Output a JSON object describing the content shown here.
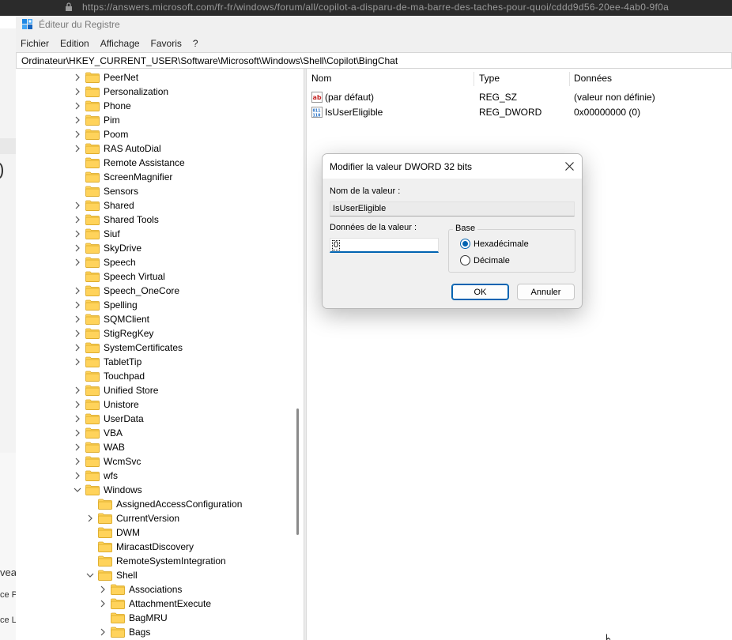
{
  "background": {
    "browser_url": "https://answers.microsoft.com/fr-fr/windows/forum/all/copilot-a-disparu-de-ma-barre-des-taches-pour-quoi/cddd9d56-20ee-4ab0-9f0a",
    "left_fragments": [
      "vea",
      "ce P",
      "ce La"
    ]
  },
  "window": {
    "title": "Éditeur du Registre",
    "icon": "registry-editor-icon"
  },
  "menu": [
    "Fichier",
    "Edition",
    "Affichage",
    "Favoris",
    "?"
  ],
  "address": "Ordinateur\\HKEY_CURRENT_USER\\Software\\Microsoft\\Windows\\Shell\\Copilot\\BingChat",
  "tree": {
    "items": [
      {
        "label": "PeerNet",
        "level": 0,
        "expander": "collapsed"
      },
      {
        "label": "Personalization",
        "level": 0,
        "expander": "collapsed"
      },
      {
        "label": "Phone",
        "level": 0,
        "expander": "collapsed"
      },
      {
        "label": "Pim",
        "level": 0,
        "expander": "collapsed"
      },
      {
        "label": "Poom",
        "level": 0,
        "expander": "collapsed"
      },
      {
        "label": "RAS AutoDial",
        "level": 0,
        "expander": "collapsed"
      },
      {
        "label": "Remote Assistance",
        "level": 0,
        "expander": "none"
      },
      {
        "label": "ScreenMagnifier",
        "level": 0,
        "expander": "none"
      },
      {
        "label": "Sensors",
        "level": 0,
        "expander": "none"
      },
      {
        "label": "Shared",
        "level": 0,
        "expander": "collapsed"
      },
      {
        "label": "Shared Tools",
        "level": 0,
        "expander": "collapsed"
      },
      {
        "label": "Siuf",
        "level": 0,
        "expander": "collapsed"
      },
      {
        "label": "SkyDrive",
        "level": 0,
        "expander": "collapsed"
      },
      {
        "label": "Speech",
        "level": 0,
        "expander": "collapsed"
      },
      {
        "label": "Speech Virtual",
        "level": 0,
        "expander": "none"
      },
      {
        "label": "Speech_OneCore",
        "level": 0,
        "expander": "collapsed"
      },
      {
        "label": "Spelling",
        "level": 0,
        "expander": "collapsed"
      },
      {
        "label": "SQMClient",
        "level": 0,
        "expander": "collapsed"
      },
      {
        "label": "StigRegKey",
        "level": 0,
        "expander": "collapsed"
      },
      {
        "label": "SystemCertificates",
        "level": 0,
        "expander": "collapsed"
      },
      {
        "label": "TabletTip",
        "level": 0,
        "expander": "collapsed"
      },
      {
        "label": "Touchpad",
        "level": 0,
        "expander": "none"
      },
      {
        "label": "Unified Store",
        "level": 0,
        "expander": "collapsed"
      },
      {
        "label": "Unistore",
        "level": 0,
        "expander": "collapsed"
      },
      {
        "label": "UserData",
        "level": 0,
        "expander": "collapsed"
      },
      {
        "label": "VBA",
        "level": 0,
        "expander": "collapsed"
      },
      {
        "label": "WAB",
        "level": 0,
        "expander": "collapsed"
      },
      {
        "label": "WcmSvc",
        "level": 0,
        "expander": "collapsed"
      },
      {
        "label": "wfs",
        "level": 0,
        "expander": "collapsed"
      },
      {
        "label": "Windows",
        "level": 0,
        "expander": "expanded"
      },
      {
        "label": "AssignedAccessConfiguration",
        "level": 1,
        "expander": "none"
      },
      {
        "label": "CurrentVersion",
        "level": 1,
        "expander": "collapsed"
      },
      {
        "label": "DWM",
        "level": 1,
        "expander": "none"
      },
      {
        "label": "MiracastDiscovery",
        "level": 1,
        "expander": "none"
      },
      {
        "label": "RemoteSystemIntegration",
        "level": 1,
        "expander": "none"
      },
      {
        "label": "Shell",
        "level": 1,
        "expander": "expanded"
      },
      {
        "label": "Associations",
        "level": 2,
        "expander": "collapsed"
      },
      {
        "label": "AttachmentExecute",
        "level": 2,
        "expander": "collapsed"
      },
      {
        "label": "BagMRU",
        "level": 2,
        "expander": "none"
      },
      {
        "label": "Bags",
        "level": 2,
        "expander": "collapsed"
      }
    ]
  },
  "values": {
    "columns": [
      "Nom",
      "Type",
      "Données"
    ],
    "rows": [
      {
        "name": "(par défaut)",
        "type": "REG_SZ",
        "data": "(valeur non définie)",
        "icon": "string-value-icon"
      },
      {
        "name": "IsUserEligible",
        "type": "REG_DWORD",
        "data": "0x00000000 (0)",
        "icon": "binary-value-icon"
      }
    ]
  },
  "dialog": {
    "title": "Modifier la valeur DWORD 32 bits",
    "name_label": "Nom de la valeur :",
    "name_value": "IsUserEligible",
    "data_label": "Données de la valeur :",
    "data_value": "0",
    "base_label": "Base",
    "radio_hex": "Hexadécimale",
    "radio_dec": "Décimale",
    "selected_base": "Hexadécimale",
    "ok": "OK",
    "cancel": "Annuler"
  },
  "colors": {
    "folder": "#ffd35b",
    "accent": "#0063b1"
  }
}
